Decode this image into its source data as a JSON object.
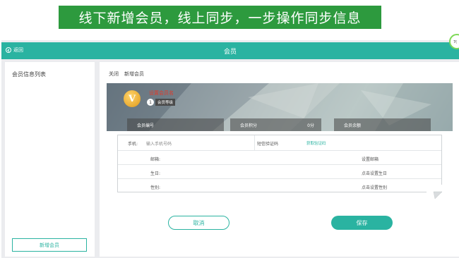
{
  "banner": {
    "text": "线下新增会员，线上同步，一步操作同步信息"
  },
  "topbar": {
    "back_label": "返回",
    "title": "会员",
    "corner_badge": "7("
  },
  "sidebar": {
    "title": "会员信息列表",
    "add_button": "新增会员"
  },
  "breadcrumb": {
    "close": "关闭",
    "current": "新增会员"
  },
  "hero": {
    "badge_letter": "V",
    "name_placeholder": "设置会员名",
    "level_number": "1",
    "level_label": "会员等级",
    "stats": {
      "member_code_label": "会员编号",
      "points_label": "会员积分",
      "points_value": "0分",
      "balance_label": "会员余额"
    }
  },
  "form": {
    "phone_label": "手机:",
    "phone_placeholder": "输入手机号码",
    "sms_label": "短信验证码",
    "get_code": "获取验证码",
    "email_label": "邮箱:",
    "email_action": "设置邮箱",
    "birthday_label": "生日:",
    "birthday_action": "点击设置生日",
    "gender_label": "性别:",
    "gender_action": "点击设置性别"
  },
  "actions": {
    "cancel": "取消",
    "save": "保存"
  },
  "colors": {
    "accent": "#2ab3a1",
    "banner": "#2d9a3e",
    "alert_text": "#e03a2a"
  }
}
